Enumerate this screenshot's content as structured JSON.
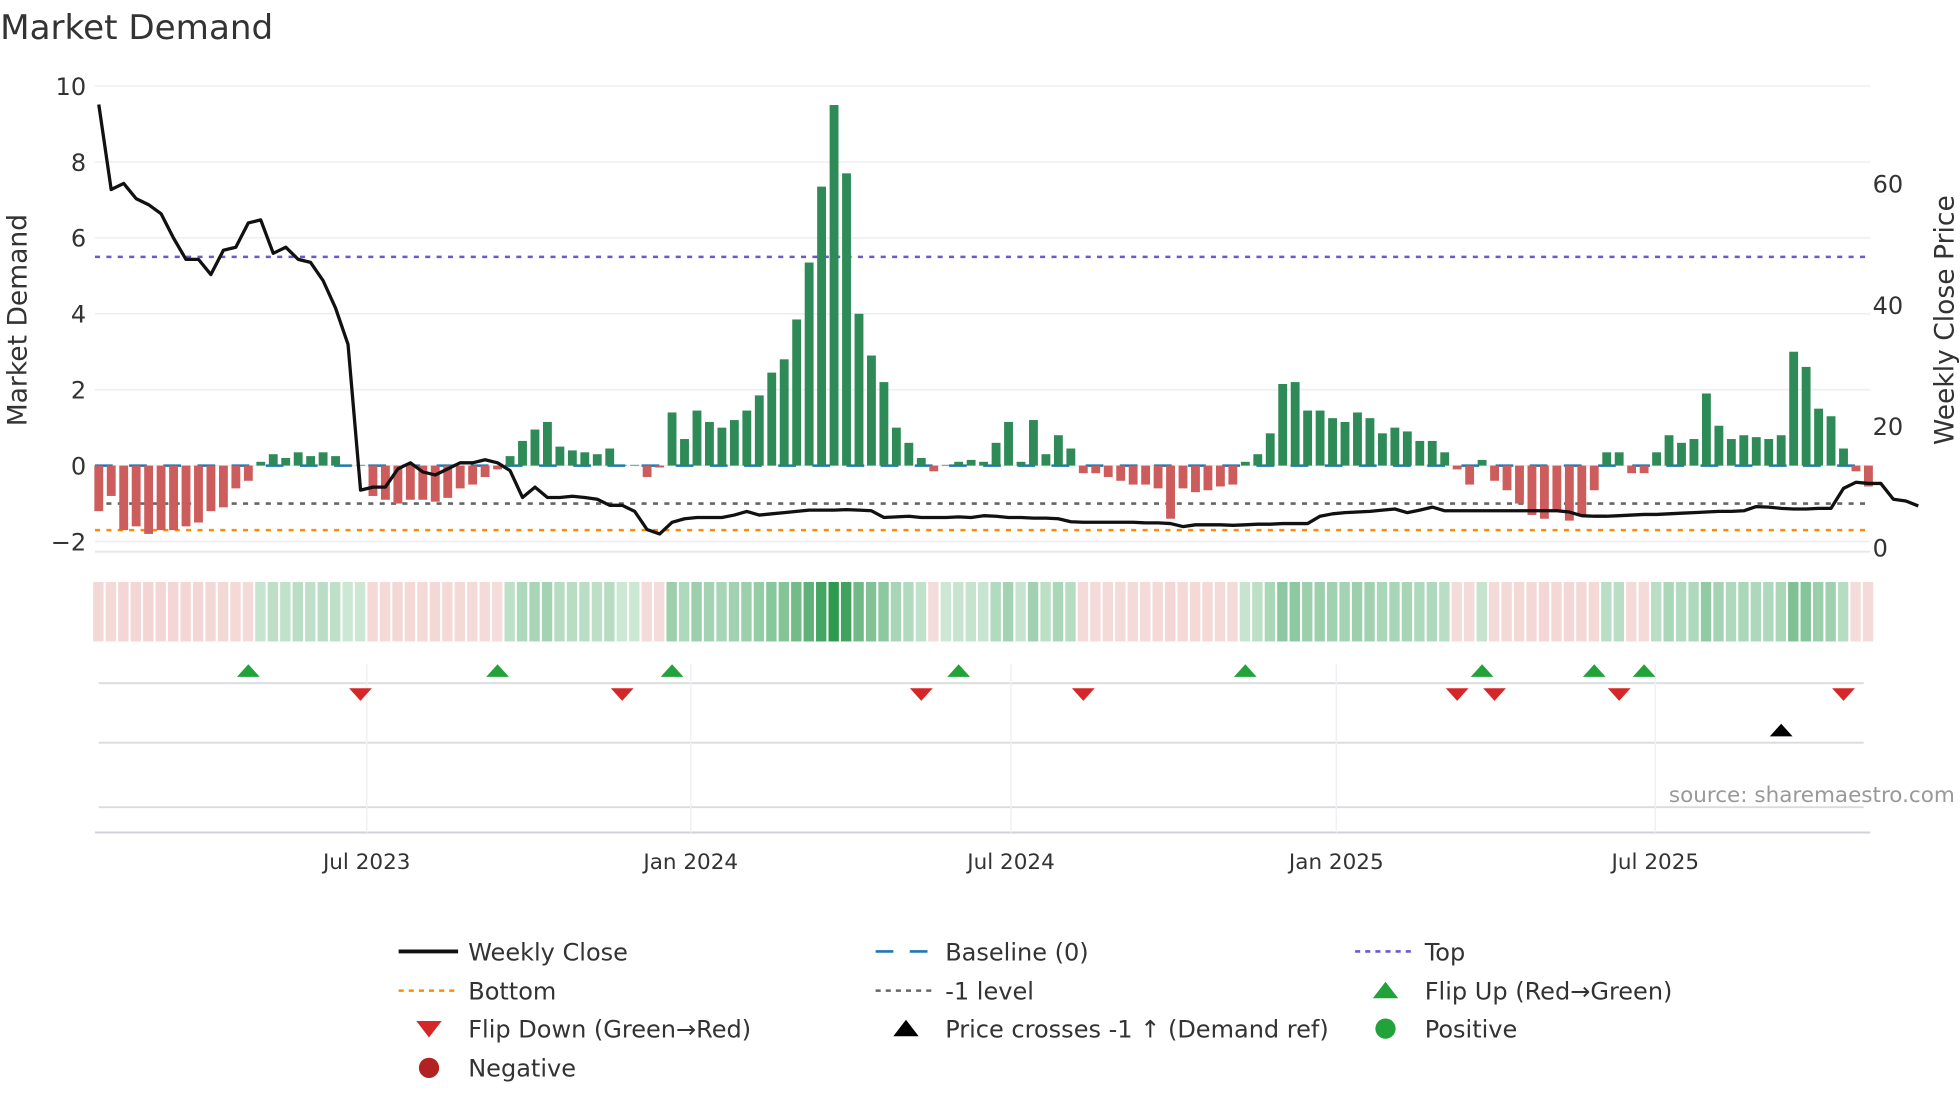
{
  "chart_data": {
    "type": "bar",
    "title": "Market Demand",
    "ylabel": "Market Demand",
    "y2label": "Weekly Close Price",
    "ylim": [
      -2.2,
      10.1
    ],
    "y2lim": [
      0,
      76.7
    ],
    "yticks": [
      "10",
      "8",
      "6",
      "4",
      "2",
      "0",
      "−2"
    ],
    "ytick_values": [
      10,
      8,
      6,
      4,
      2,
      0,
      -2
    ],
    "y2ticks": [
      "60",
      "40",
      "20",
      "0"
    ],
    "y2tick_values": [
      60,
      40,
      20,
      0
    ],
    "xticks": [
      "Jul 2023",
      "Jan 2024",
      "Jul 2024",
      "Jan 2025",
      "Jul 2025"
    ],
    "xtick_weeks": [
      21.5,
      47.5,
      73.2,
      99.3,
      124.9
    ],
    "x_start": "2023-02-10",
    "x_unit": "week",
    "grid": true,
    "reference_lines": {
      "top": 5.5,
      "bottom": -1.7,
      "minus_one": -1,
      "baseline": 0
    },
    "demand": [
      -1.2,
      -0.8,
      -1.7,
      -1.6,
      -1.8,
      -1.7,
      -1.7,
      -1.6,
      -1.5,
      -1.2,
      -1.1,
      -0.6,
      -0.4,
      0.1,
      0.3,
      0.2,
      0.35,
      0.25,
      0.35,
      0.25,
      0.02,
      0.02,
      -0.8,
      -0.9,
      -1.0,
      -0.9,
      -0.9,
      -0.95,
      -0.85,
      -0.6,
      -0.5,
      -0.3,
      -0.1,
      0.25,
      0.65,
      0.95,
      1.15,
      0.5,
      0.4,
      0.35,
      0.3,
      0.45,
      0.02,
      0.02,
      -0.3,
      -0.05,
      1.4,
      0.7,
      1.45,
      1.15,
      1.0,
      1.2,
      1.45,
      1.85,
      2.45,
      2.8,
      3.85,
      5.35,
      7.35,
      9.5,
      7.7,
      4.0,
      2.9,
      2.2,
      1.0,
      0.6,
      0.2,
      -0.15,
      0.02,
      0.1,
      0.15,
      0.1,
      0.6,
      1.15,
      0.1,
      1.2,
      0.3,
      0.8,
      0.45,
      -0.2,
      -0.2,
      -0.3,
      -0.4,
      -0.5,
      -0.5,
      -0.6,
      -1.4,
      -0.6,
      -0.7,
      -0.65,
      -0.55,
      -0.5,
      0.1,
      0.3,
      0.85,
      2.15,
      2.2,
      1.45,
      1.45,
      1.25,
      1.15,
      1.4,
      1.25,
      0.85,
      1.0,
      0.9,
      0.65,
      0.65,
      0.35,
      -0.1,
      -0.5,
      0.15,
      -0.4,
      -0.65,
      -1.0,
      -1.3,
      -1.4,
      -1.2,
      -1.45,
      -1.3,
      -0.65,
      0.35,
      0.35,
      -0.2,
      -0.2,
      0.35,
      0.8,
      0.6,
      0.7,
      1.9,
      1.05,
      0.7,
      0.8,
      0.75,
      0.7,
      0.8,
      3.0,
      2.6,
      1.5,
      1.3,
      0.45,
      -0.15,
      -0.55
    ],
    "weekly_close": [
      73,
      59,
      60,
      57.5,
      56.5,
      55,
      51,
      47.5,
      47.5,
      45,
      49,
      49.5,
      53.5,
      54,
      48.5,
      49.5,
      47.5,
      47,
      44,
      39.5,
      33.5,
      9.5,
      10,
      10,
      13,
      14,
      12.5,
      12,
      13,
      14,
      14,
      14.5,
      14,
      12.7,
      8.3,
      10,
      8.3,
      8.3,
      8.5,
      8.3,
      8,
      7,
      7,
      6,
      3,
      2.3,
      4.2,
      4.8,
      5,
      5,
      5,
      5.4,
      6,
      5.4,
      5.6,
      5.8,
      6,
      6.2,
      6.2,
      6.2,
      6.3,
      6.2,
      6.1,
      5,
      5.1,
      5.2,
      5,
      5,
      5,
      5.1,
      5,
      5.3,
      5.2,
      5,
      5,
      4.9,
      4.9,
      4.8,
      4.3,
      4.2,
      4.2,
      4.2,
      4.2,
      4.2,
      4.1,
      4.1,
      4,
      3.5,
      3.8,
      3.8,
      3.8,
      3.7,
      3.8,
      3.9,
      3.9,
      4,
      4,
      4,
      5.2,
      5.6,
      5.8,
      5.9,
      6,
      6.2,
      6.4,
      5.8,
      6.2,
      6.7,
      6.1,
      6.1,
      6.1,
      6.1,
      6.1,
      6.1,
      6.1,
      6.1,
      6.1,
      6.1,
      5.9,
      5.3,
      5.2,
      5.2,
      5.3,
      5.4,
      5.5,
      5.5,
      5.6,
      5.7,
      5.8,
      5.9,
      6,
      6,
      6.1,
      6.8,
      6.7,
      6.5,
      6.4,
      6.4,
      6.5,
      6.5,
      9.8,
      10.8,
      10.6,
      10.6,
      8,
      7.7,
      6.9
    ],
    "flip_up_weeks": [
      12,
      32,
      46,
      69,
      92,
      111,
      120,
      124
    ],
    "flip_down_weeks": [
      21,
      42,
      66,
      79,
      109,
      112,
      122,
      140
    ],
    "price_cross_weeks": [
      135
    ],
    "legend": [
      {
        "label": "Weekly Close",
        "symbol": "line",
        "color": "#111111"
      },
      {
        "label": "Baseline (0)",
        "symbol": "dash",
        "color": "#1f77b4"
      },
      {
        "label": "Top",
        "symbol": "dot",
        "color": "#6a5acd"
      },
      {
        "label": "Bottom",
        "symbol": "dot",
        "color": "#ff8c00"
      },
      {
        "label": "-1 level",
        "symbol": "dot",
        "color": "#666666"
      },
      {
        "label": "Flip Up (Red→Green)",
        "symbol": "tri-up",
        "color": "#22a33a"
      },
      {
        "label": "Flip Down (Green→Red)",
        "symbol": "tri-down",
        "color": "#d62728"
      },
      {
        "label": "Price crosses -1 ↑ (Demand ref)",
        "symbol": "tri-up",
        "color": "#000000"
      },
      {
        "label": "Positive",
        "symbol": "circle",
        "color": "#22a33a"
      },
      {
        "label": "Negative",
        "symbol": "circle",
        "color": "#b22222"
      }
    ],
    "legend_placement": "bottom"
  },
  "colors": {
    "positive": "#2e8b57",
    "negative": "#cd5c5c",
    "heat_pos": "#2e9a4f",
    "heat_neg": "#d9807c"
  },
  "source": "source: sharemaestro.com"
}
